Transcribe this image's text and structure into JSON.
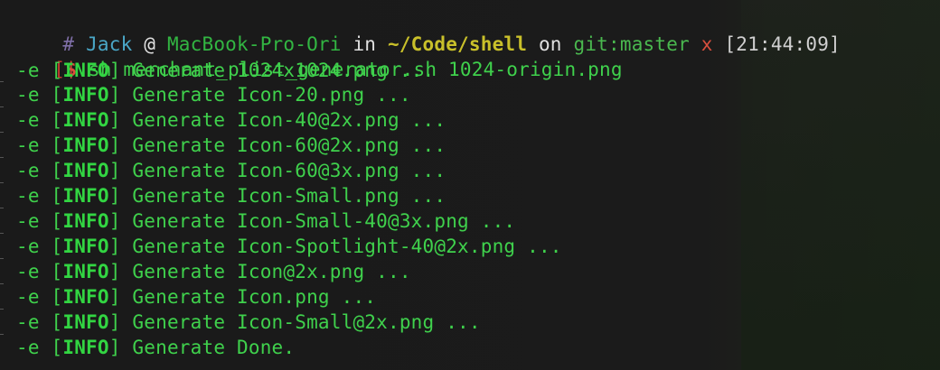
{
  "prompt": {
    "hash": "#",
    "user": "Jack",
    "at": "@",
    "host": "MacBook-Pro-Ori",
    "in": "in",
    "path": "~/Code/shell",
    "on": "on",
    "git_label": "git:",
    "branch": "master",
    "dirty": "x",
    "time": "[21:44:09]"
  },
  "command": {
    "bracket": "[",
    "dollar": "$",
    "text": " sh merchant_plist_generator.sh 1024-origin.png"
  },
  "output": [
    {
      "prefix": "-e ",
      "lb": "[",
      "tag": "INFO",
      "rb": "]",
      "msg": " Generate 1024x1024.png ..."
    },
    {
      "prefix": "-e ",
      "lb": "[",
      "tag": "INFO",
      "rb": "]",
      "msg": " Generate Icon-20.png ..."
    },
    {
      "prefix": "-e ",
      "lb": "[",
      "tag": "INFO",
      "rb": "]",
      "msg": " Generate Icon-40@2x.png ..."
    },
    {
      "prefix": "-e ",
      "lb": "[",
      "tag": "INFO",
      "rb": "]",
      "msg": " Generate Icon-60@2x.png ..."
    },
    {
      "prefix": "-e ",
      "lb": "[",
      "tag": "INFO",
      "rb": "]",
      "msg": " Generate Icon-60@3x.png ..."
    },
    {
      "prefix": "-e ",
      "lb": "[",
      "tag": "INFO",
      "rb": "]",
      "msg": " Generate Icon-Small.png ..."
    },
    {
      "prefix": "-e ",
      "lb": "[",
      "tag": "INFO",
      "rb": "]",
      "msg": " Generate Icon-Small-40@3x.png ..."
    },
    {
      "prefix": "-e ",
      "lb": "[",
      "tag": "INFO",
      "rb": "]",
      "msg": " Generate Icon-Spotlight-40@2x.png ..."
    },
    {
      "prefix": "-e ",
      "lb": "[",
      "tag": "INFO",
      "rb": "]",
      "msg": " Generate Icon@2x.png ..."
    },
    {
      "prefix": "-e ",
      "lb": "[",
      "tag": "INFO",
      "rb": "]",
      "msg": " Generate Icon.png ..."
    },
    {
      "prefix": "-e ",
      "lb": "[",
      "tag": "INFO",
      "rb": "]",
      "msg": " Generate Icon-Small@2x.png ..."
    },
    {
      "prefix": "-e ",
      "lb": "[",
      "tag": "INFO",
      "rb": "]",
      "msg": " Generate Done."
    }
  ]
}
